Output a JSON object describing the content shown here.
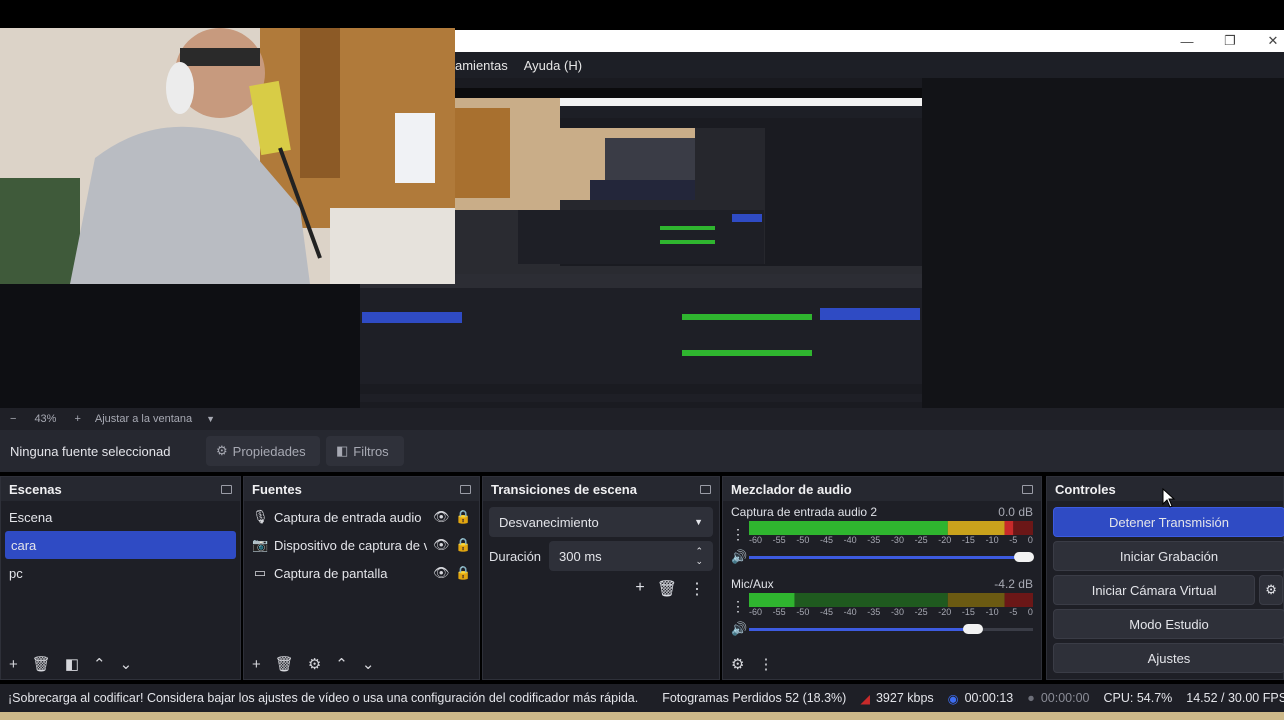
{
  "window": {
    "minimize_glyph": "—",
    "maximize_glyph": "❐",
    "close_glyph": "✕"
  },
  "menubar": {
    "items": [
      "amientas",
      "Ayuda (H)"
    ]
  },
  "zoom": {
    "minus": "−",
    "value": "43%",
    "plus": "+",
    "fit_label": "Ajustar a la ventana"
  },
  "source_toolbar": {
    "none_selected": "Ninguna fuente seleccionad",
    "properties": "Propiedades",
    "filters": "Filtros"
  },
  "scenes": {
    "title": "Escenas",
    "items": [
      "Escena",
      "cara",
      "pc"
    ],
    "selected_index": 1
  },
  "sources": {
    "title": "Fuentes",
    "items": [
      {
        "label": "Captura de entrada audio",
        "icon": "microphone-icon"
      },
      {
        "label": "Dispositivo de captura de v",
        "icon": "camera-icon"
      },
      {
        "label": "Captura de pantalla",
        "icon": "monitor-icon"
      }
    ]
  },
  "transitions": {
    "title": "Transiciones de escena",
    "selected": "Desvanecimiento",
    "duration_label": "Duración",
    "duration_value": "300 ms"
  },
  "mixer": {
    "title": "Mezclador de audio",
    "channels": [
      {
        "name": "Captura de entrada audio 2",
        "db": "0.0 dB",
        "level": 0.93,
        "volume": 0.97
      },
      {
        "name": "Mic/Aux",
        "db": "-4.2 dB",
        "level": 0.16,
        "volume": 0.79
      }
    ],
    "scale": [
      "-60",
      "-55",
      "-50",
      "-45",
      "-40",
      "-35",
      "-30",
      "-25",
      "-20",
      "-15",
      "-10",
      "-5",
      "0"
    ]
  },
  "controls": {
    "title": "Controles",
    "stop_stream": "Detener Transmisión",
    "start_recording": "Iniciar Grabación",
    "start_virtual_cam": "Iniciar Cámara Virtual",
    "studio_mode": "Modo Estudio",
    "settings": "Ajustes"
  },
  "status": {
    "warning": "¡Sobrecarga al codificar! Considera bajar los ajustes de vídeo o usa una configuración del codificador más rápida.",
    "dropped_frames": "Fotogramas Perdidos 52 (18.3%)",
    "bitrate": "3927 kbps",
    "stream_time": "00:00:13",
    "rec_time": "00:00:00",
    "cpu": "CPU: 54.7%",
    "fps": "14.52 / 30.00 FPS"
  },
  "colors": {
    "accent": "#2f4bc4",
    "meter_green": "#2fb52f",
    "meter_yellow": "#c9a21c",
    "meter_red": "#c82a2a"
  }
}
